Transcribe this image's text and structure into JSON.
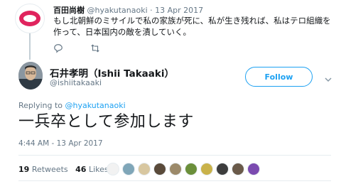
{
  "parent_tweet": {
    "display_name": "百田尚樹",
    "handle": "@hyakutanaoki",
    "separator": "·",
    "date": "13 Apr 2017",
    "text": "もし北朝鮮のミサイルで私の家族が死に、私が生き残れば、私はテロ組織を作って、日本国内の敵を潰していく。",
    "actions": [
      "reply-icon",
      "retweet-icon"
    ]
  },
  "main_tweet": {
    "display_name": "石井孝明（Ishii Takaaki）",
    "handle": "@ishiitakaaki",
    "follow_label": "Follow",
    "replying_prefix": "Replying to",
    "replying_to": "@hyakutanaoki",
    "text": "一兵卒として参加します",
    "timestamp": "4:44 AM - 13 Apr 2017",
    "retweets_count": "19",
    "retweets_label": "Retweets",
    "likes_count": "46",
    "likes_label": "Likes",
    "liker_colors": [
      "#f2f2f2",
      "#7fa6b8",
      "#d8c7a0",
      "#5a4a3a",
      "#9c8a6a",
      "#6b8f3a",
      "#c9b24a",
      "#3d3d3d",
      "#6a5a4a",
      "#7b4bb0"
    ]
  },
  "colors": {
    "accent": "#1da1f2",
    "brand_logo": "#e0245e",
    "muted_text": "#657786"
  }
}
